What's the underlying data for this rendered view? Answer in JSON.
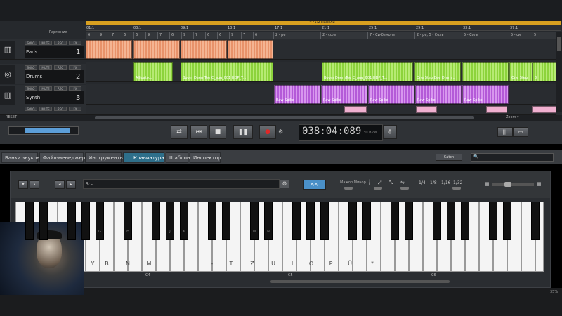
{
  "arranger": {
    "arrangement_label": "Гармоник",
    "loop_text": "~71:2 Панели",
    "ruler": [
      "01:1",
      "03:1",
      "09:1",
      "13:1",
      "17:1",
      "21:1",
      "25:1",
      "29:1",
      "33:1",
      "37:1"
    ],
    "markers": [
      "6",
      "9",
      "7",
      "6",
      "6",
      "9",
      "7",
      "6",
      "9",
      "7",
      "6",
      "6",
      "9",
      "7",
      "6",
      "2 - ре",
      "2 - соль",
      "7 - Си-бемоль",
      "2 - ре, 5 - Соль",
      "5 - Соль",
      "5 - си",
      "5"
    ],
    "tracks": [
      {
        "name": "Pads",
        "number": "1",
        "icon": "▥",
        "buttons": [
          "SOLO",
          "MUTE",
          "REC",
          "FX"
        ]
      },
      {
        "name": "Drums",
        "number": "2",
        "icon": "◎",
        "buttons": [
          "SOLO",
          "MUTE",
          "REC",
          "FX"
        ]
      },
      {
        "name": "Synth",
        "number": "3",
        "icon": "▥",
        "buttons": [
          "SOLO",
          "MUTE",
          "REC",
          "FX"
        ]
      }
    ],
    "clips": {
      "drums": [
        "Alligato...",
        "Boom DeemTee C_agg_001 HDP_T...",
        "",
        "Boom DeemTee C_agg_001 HDP_T...",
        "",
        "One Step Bee Drum...",
        "One Step",
        "0"
      ],
      "synth": [
        "Raw Spike",
        "Raw Spike",
        "Raw Spike",
        "Raw Spike",
        "Raw Spike",
        "Raw Spike"
      ]
    },
    "reset_label": "RESET",
    "zoom_label": "Zoom ▾"
  },
  "transport": {
    "time": "038:04:089",
    "bpm": "130 BPM",
    "buttons": {
      "loop": "⇄",
      "start": "⏮",
      "stop": "■",
      "pause": "❚❚",
      "record": "●",
      "settings": "⚙",
      "metronome": "⍋"
    }
  },
  "tabs": [
    "Банки звуков",
    "Файл-менеджер",
    "Инструменты",
    "Клавиатура",
    "Шаблон",
    "Инспектор"
  ],
  "active_tab": "Клавиатура",
  "catch_label": "Catch",
  "search": {
    "placeholder": "🔍"
  },
  "keyboard": {
    "preset": "5: -",
    "arp_label": "∿∿",
    "mode_label": "Мажор Минор",
    "divisions": [
      "1/4",
      "1/8",
      "1/16",
      "1/32"
    ],
    "black_key_labels": [
      "",
      "",
      "",
      "",
      "",
      "G",
      "H",
      "",
      "J",
      "K",
      "",
      "L",
      "M",
      "N",
      "",
      "",
      "",
      "",
      "",
      "",
      "",
      ""
    ],
    "white_key_labels": [
      "",
      "",
      "",
      "",
      "",
      "",
      "Y",
      "B",
      "N",
      "M",
      ":",
      ":",
      "-",
      "T",
      "Z",
      "U",
      "I",
      "O",
      "P",
      "Ü",
      "*"
    ],
    "octaves": [
      "C4",
      "C5",
      "C6"
    ]
  },
  "status": {
    "percent": "35%"
  }
}
